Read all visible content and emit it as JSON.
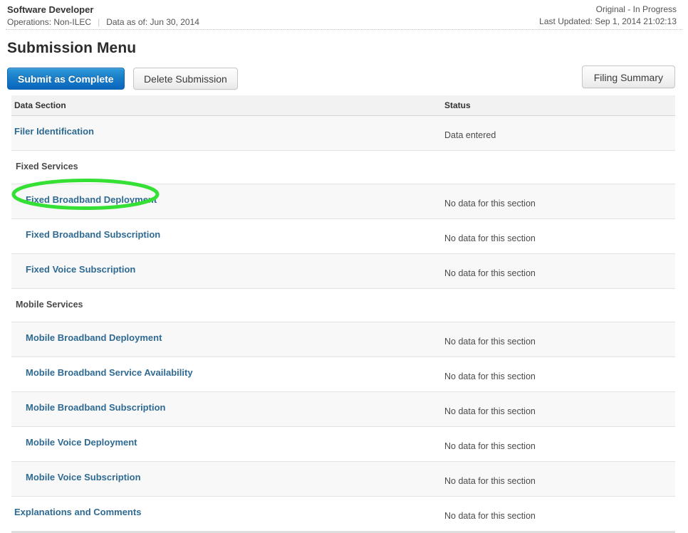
{
  "header": {
    "filer_name": "Software Developer",
    "operations_label": "Operations:",
    "operations_value": "Non-ILEC",
    "operations_line": "Operations: Non-ILEC",
    "data_as_of": "Data as of: Jun 30, 2014",
    "filing_status": "Original - In Progress",
    "last_updated": "Last Updated: Sep 1, 2014 21:02:13"
  },
  "page": {
    "title": "Submission Menu"
  },
  "toolbar": {
    "submit_label": "Submit as Complete",
    "delete_label": "Delete Submission",
    "filing_summary_label": "Filing Summary",
    "primary_color": "#1a7ec8",
    "link_color": "#2f6a92"
  },
  "table": {
    "columns": {
      "section": "Data Section",
      "status": "Status"
    },
    "rows": [
      {
        "kind": "item",
        "indent": 0,
        "label": "Filer Identification",
        "status": "Data entered",
        "shade": "shade"
      },
      {
        "kind": "group",
        "indent": 0,
        "label": "Fixed Services",
        "status": "",
        "shade": "plain"
      },
      {
        "kind": "item",
        "indent": 1,
        "label": "Fixed Broadband Deployment",
        "status": "No data for this section",
        "shade": "shade"
      },
      {
        "kind": "item",
        "indent": 1,
        "label": "Fixed Broadband Subscription",
        "status": "No data for this section",
        "shade": "plain"
      },
      {
        "kind": "item",
        "indent": 1,
        "label": "Fixed Voice Subscription",
        "status": "No data for this section",
        "shade": "shade"
      },
      {
        "kind": "group",
        "indent": 0,
        "label": "Mobile Services",
        "status": "",
        "shade": "plain"
      },
      {
        "kind": "item",
        "indent": 1,
        "label": "Mobile Broadband Deployment",
        "status": "No data for this section",
        "shade": "shade"
      },
      {
        "kind": "item",
        "indent": 1,
        "label": "Mobile Broadband Service Availability",
        "status": "No data for this section",
        "shade": "plain"
      },
      {
        "kind": "item",
        "indent": 1,
        "label": "Mobile Broadband Subscription",
        "status": "No data for this section",
        "shade": "shade"
      },
      {
        "kind": "item",
        "indent": 1,
        "label": "Mobile Voice Deployment",
        "status": "No data for this section",
        "shade": "plain"
      },
      {
        "kind": "item",
        "indent": 1,
        "label": "Mobile Voice Subscription",
        "status": "No data for this section",
        "shade": "shade"
      },
      {
        "kind": "item",
        "indent": 0,
        "label": "Explanations and Comments",
        "status": "No data for this section",
        "shade": "plain"
      }
    ]
  },
  "annotation": {
    "target_label": "Fixed Broadband Deployment",
    "shape": "ellipse",
    "color": "#35e035"
  }
}
